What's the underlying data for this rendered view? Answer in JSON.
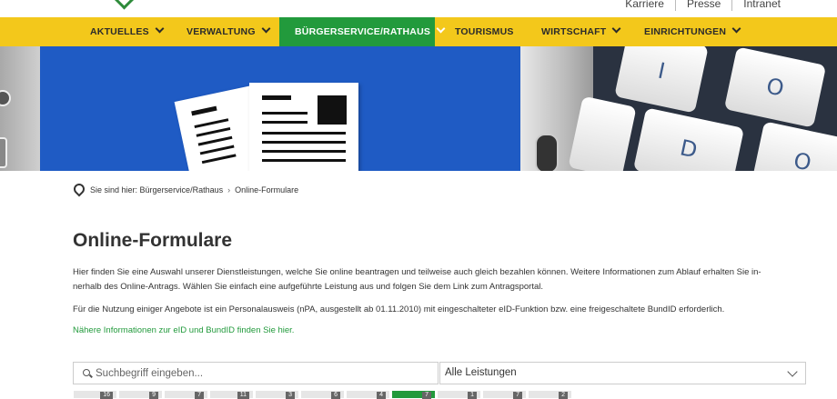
{
  "toplinks": [
    "Karriere",
    "Presse",
    "Intranet"
  ],
  "nav": [
    {
      "label": "AKTUELLES",
      "dropdown": true
    },
    {
      "label": "VERWALTUNG",
      "dropdown": true
    },
    {
      "label": "BÜRGERSERVICE/RATHAUS",
      "dropdown": true,
      "active": true
    },
    {
      "label": "TOURISMUS",
      "dropdown": false
    },
    {
      "label": "WIRTSCHAFT",
      "dropdown": true
    },
    {
      "label": "EINRICHTUNGEN",
      "dropdown": true
    }
  ],
  "hero": {
    "keys": [
      "I",
      "O",
      "D",
      "O"
    ]
  },
  "breadcrumb": {
    "prefix": "Sie sind hier:",
    "items": [
      "Bürgerservice/Rathaus",
      "Online-Formulare"
    ]
  },
  "main": {
    "title": "Online-Formulare",
    "intro_line1": "Hier finden Sie eine Auswahl unserer Dienstleistungen, welche Sie online beantragen und teilweise auch gleich bezahlen können. Weitere Informationen zum Ablauf erhalten Sie in-",
    "intro_line2": "nerhalb des Online-Antrags. Wählen Sie einfach eine aufgeführte Leistung aus und folgen Sie dem Link zum Antragsportal.",
    "note": "Für die Nutzung einiger Angebote ist ein Personalausweis (nPA, ausgestellt ab 01.11.2010) mit eingeschalteter eID-Funktion bzw. eine freigeschaltete BundID erforderlich.",
    "info_link": "Nähere Informationen zur eID und BundID finden Sie hier."
  },
  "search": {
    "placeholder": "Suchbegriff eingeben..."
  },
  "filter": {
    "selected": "Alle Leistungen"
  },
  "letters": [
    {
      "count": "16"
    },
    {
      "count": "9"
    },
    {
      "count": "7"
    },
    {
      "count": "11"
    },
    {
      "count": "3"
    },
    {
      "count": "6"
    },
    {
      "count": "4"
    },
    {
      "count": "7",
      "active": true
    },
    {
      "count": "1"
    },
    {
      "count": "7"
    },
    {
      "count": "2"
    }
  ],
  "colors": {
    "accent_green": "#229a3c",
    "nav_yellow": "#f3c81b",
    "hero_blue": "#1f5bc4"
  }
}
